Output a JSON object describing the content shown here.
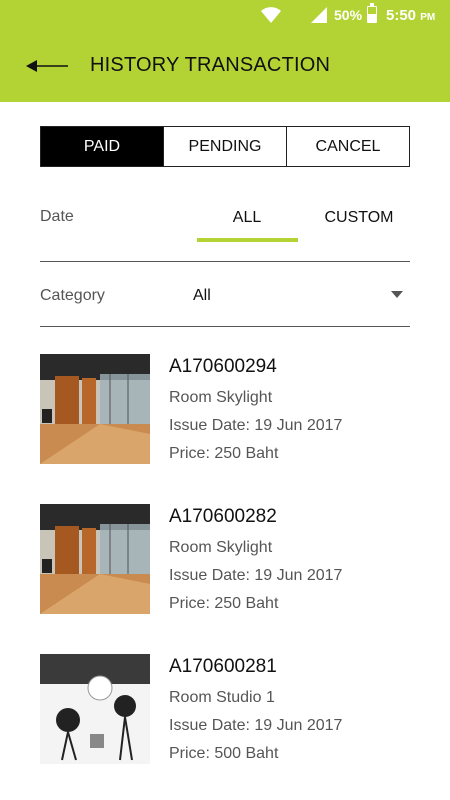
{
  "status_bar": {
    "battery": "50%",
    "time": "5:50",
    "ampm": "PM"
  },
  "header": {
    "title": "HISTORY TRANSACTION",
    "back_icon": "arrow-left-icon"
  },
  "tabs": [
    {
      "label": "PAID",
      "active": true
    },
    {
      "label": "PENDING",
      "active": false
    },
    {
      "label": "CANCEL",
      "active": false
    }
  ],
  "date_filter": {
    "label": "Date",
    "options": [
      "ALL",
      "CUSTOM"
    ],
    "selected": "ALL"
  },
  "category_filter": {
    "label": "Category",
    "value": "All"
  },
  "transactions": [
    {
      "code": "A170600294",
      "room": "Room Skylight",
      "issue_date": "Issue Date: 19 Jun 2017",
      "price": "Price: 250 Baht",
      "image": "skylight-room-photo"
    },
    {
      "code": "A170600282",
      "room": "Room Skylight",
      "issue_date": "Issue Date: 19 Jun 2017",
      "price": "Price: 250 Baht",
      "image": "skylight-room-photo"
    },
    {
      "code": "A170600281",
      "room": "Room Studio 1",
      "issue_date": "Issue Date: 19 Jun 2017",
      "price": "Price: 500 Baht",
      "image": "studio-room-photo"
    }
  ],
  "colors": {
    "accent": "#b3d334",
    "active_tab_bg": "#000000"
  }
}
